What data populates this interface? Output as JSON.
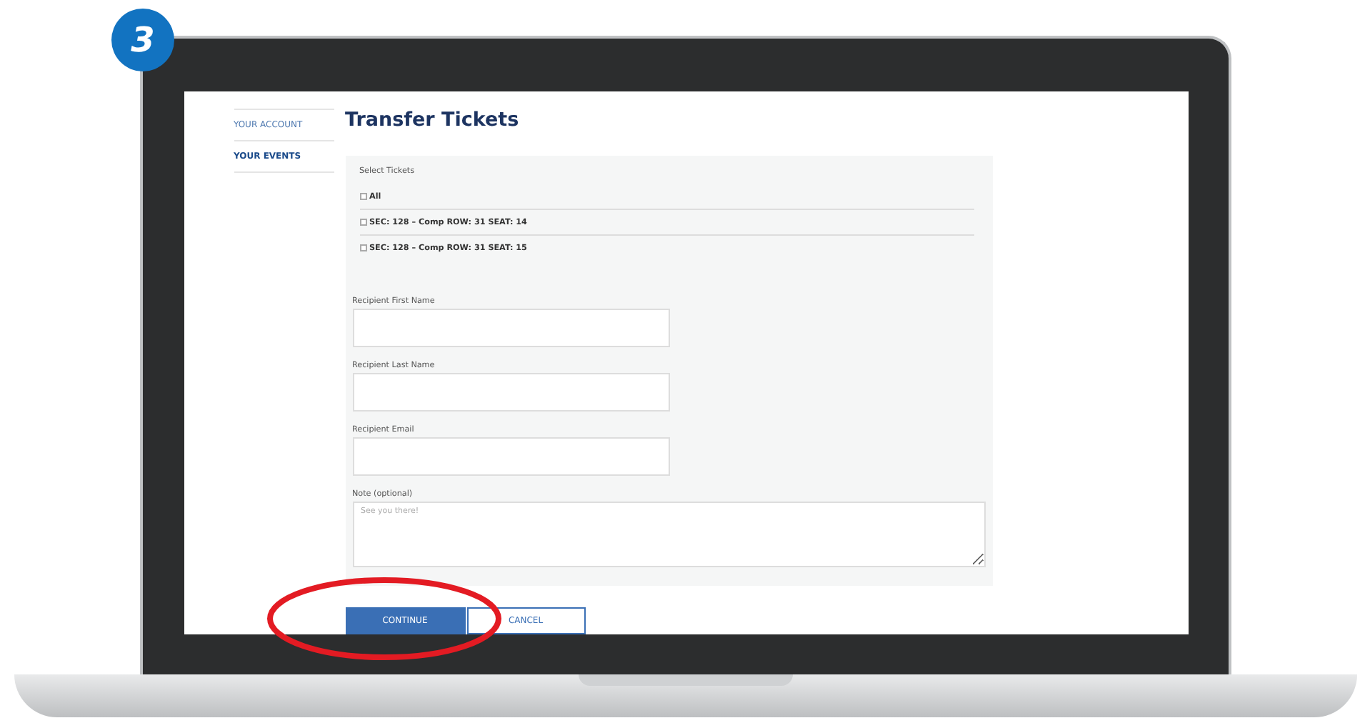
{
  "step_badge": "3",
  "sidebar": {
    "items": [
      {
        "label": "YOUR ACCOUNT",
        "selected": false
      },
      {
        "label": "YOUR EVENTS",
        "selected": true
      }
    ]
  },
  "title": "Transfer Tickets",
  "select_tickets": {
    "label": "Select Tickets",
    "options": [
      {
        "label": "All",
        "checked": false
      },
      {
        "label": "SEC: 128 – Comp ROW: 31 SEAT: 14",
        "checked": false
      },
      {
        "label": "SEC: 128 – Comp ROW: 31 SEAT: 15",
        "checked": false
      }
    ]
  },
  "fields": [
    {
      "label": "Recipient First Name",
      "kind": "input"
    },
    {
      "label": "Recipient Last Name",
      "kind": "input"
    },
    {
      "label": "Recipient Email",
      "kind": "input"
    },
    {
      "label": "Note (optional)",
      "kind": "textarea",
      "placeholder": "See you there!"
    }
  ],
  "buttons": [
    {
      "label": "CONTINUE",
      "kind": "primary"
    },
    {
      "label": "CANCEL",
      "kind": "secondary"
    }
  ]
}
